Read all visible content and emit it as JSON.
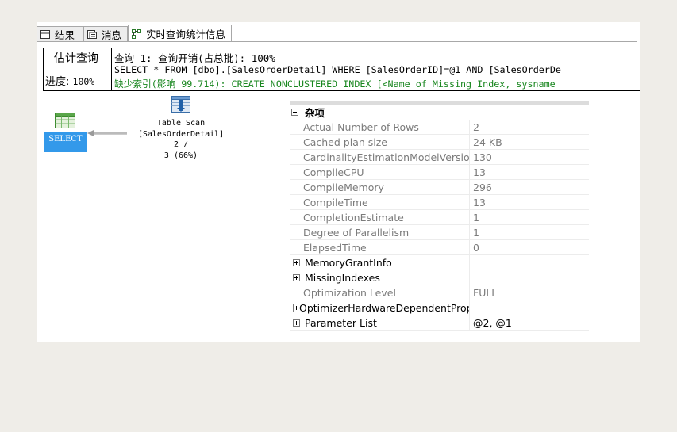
{
  "tabs": [
    {
      "label": "结果",
      "icon": "grid-icon"
    },
    {
      "label": "消息",
      "icon": "messages-icon"
    },
    {
      "label": "实时查询统计信息",
      "icon": "live-stats-icon"
    }
  ],
  "header": {
    "estimate_label": "估计查询",
    "progress_label": "进度:",
    "progress_value": "100%",
    "query_line": "查询 1: 查询开销(占总批): 100%",
    "sql_line": "SELECT * FROM [dbo].[SalesOrderDetail] WHERE [SalesOrderID]=@1 AND [SalesOrderDe",
    "missing_index_line": "缺少索引(影响 99.714): CREATE NONCLUSTERED INDEX [<Name of Missing Index, sysname"
  },
  "plan": {
    "select_label": "SELECT",
    "table_scan": {
      "title": "Table Scan",
      "object": "[SalesOrderDetail]",
      "rows_line": "2 /",
      "cost_line": "3 (66%)"
    }
  },
  "properties": {
    "category": "杂项",
    "rows": [
      {
        "name": "Actual Number of Rows",
        "value": "2",
        "group": false
      },
      {
        "name": "Cached plan size",
        "value": "24 KB",
        "group": false
      },
      {
        "name": "CardinalityEstimationModelVersion",
        "value": "130",
        "group": false
      },
      {
        "name": "CompileCPU",
        "value": "13",
        "group": false
      },
      {
        "name": "CompileMemory",
        "value": "296",
        "group": false
      },
      {
        "name": "CompileTime",
        "value": "13",
        "group": false
      },
      {
        "name": "CompletionEstimate",
        "value": "1",
        "group": false
      },
      {
        "name": "Degree of Parallelism",
        "value": "1",
        "group": false
      },
      {
        "name": "ElapsedTime",
        "value": "0",
        "group": false
      },
      {
        "name": "MemoryGrantInfo",
        "value": "",
        "group": true
      },
      {
        "name": "MissingIndexes",
        "value": "",
        "group": true
      },
      {
        "name": "Optimization Level",
        "value": "FULL",
        "group": false
      },
      {
        "name": "OptimizerHardwareDependentProperti",
        "value": "",
        "group": true
      },
      {
        "name": "Parameter List",
        "value": "@2, @1",
        "group": true
      }
    ]
  },
  "colors": {
    "select_bg": "#3399ea",
    "missing_index_text": "#18861e",
    "property_name_text": "#7b7b7b"
  }
}
